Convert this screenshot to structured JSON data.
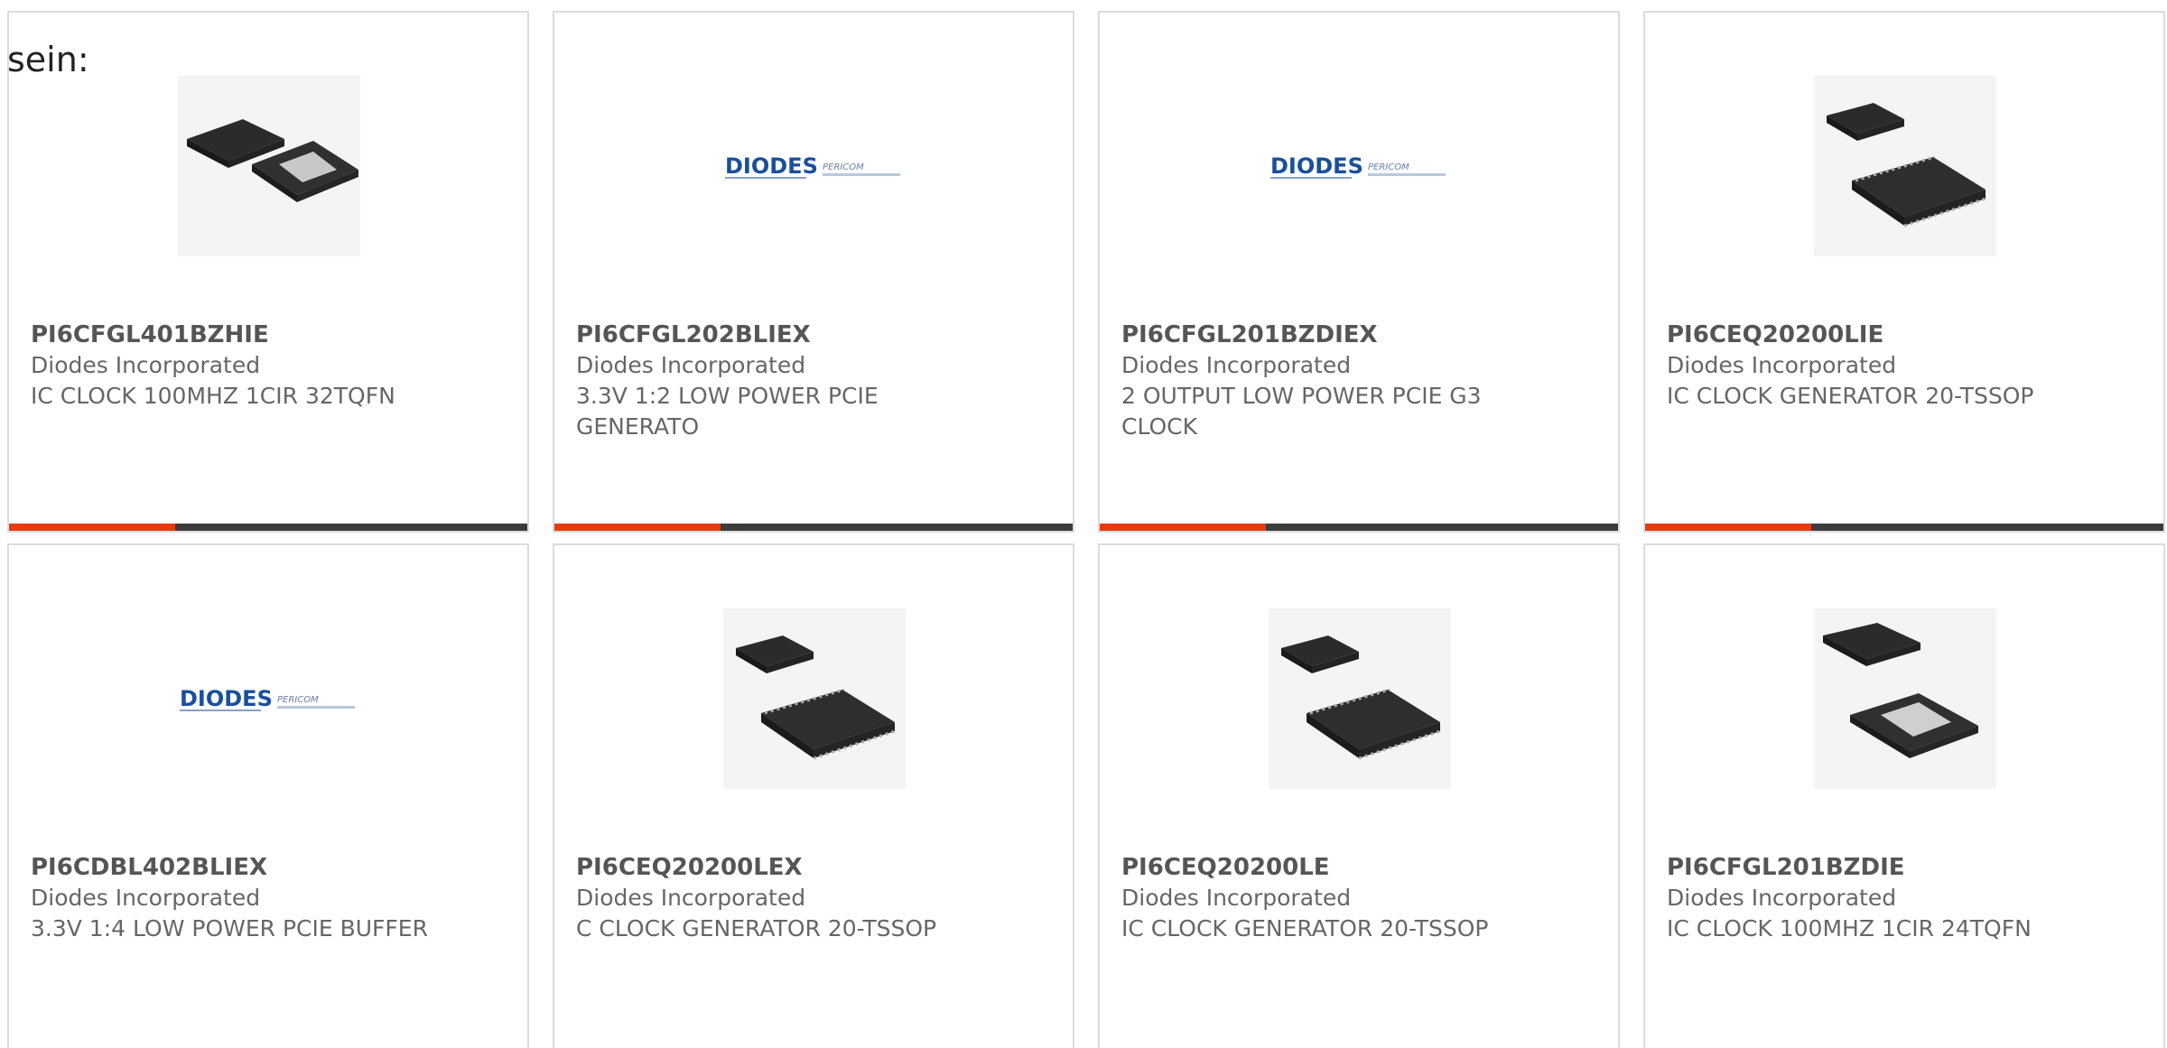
{
  "prefix_text": "sein:",
  "accent_color": "#e63a10",
  "bar_color": "#3c3c3c",
  "products": [
    {
      "part_number": "PI6CFGL401BZHIE",
      "manufacturer": "Diodes Incorporated",
      "description": "IC CLOCK 100MHZ 1CIR 32TQFN",
      "image": "qfn-chip-icon",
      "bar_fill": 0.32
    },
    {
      "part_number": "PI6CFGL202BLIEX",
      "manufacturer": "Diodes Incorporated",
      "description": "3.3V 1:2 LOW POWER PCIE GENERATO",
      "image": "diodes-pericom-logo",
      "bar_fill": 0.32
    },
    {
      "part_number": "PI6CFGL201BZDIEX",
      "manufacturer": "Diodes Incorporated",
      "description": "2 OUTPUT LOW POWER PCIE G3 CLOCK",
      "image": "diodes-pericom-logo",
      "bar_fill": 0.32
    },
    {
      "part_number": "PI6CEQ20200LIE",
      "manufacturer": "Diodes Incorporated",
      "description": "IC CLOCK GENERATOR 20-TSSOP",
      "image": "tssop-chip-icon",
      "bar_fill": 0.32
    },
    {
      "part_number": "PI6CDBL402BLIEX",
      "manufacturer": "Diodes Incorporated",
      "description": "3.3V 1:4 LOW POWER PCIE BUFFER",
      "image": "diodes-pericom-logo",
      "bar_fill": null
    },
    {
      "part_number": "PI6CEQ20200LEX",
      "manufacturer": "Diodes Incorporated",
      "description": "C CLOCK GENERATOR 20-TSSOP",
      "image": "tssop-chip-icon",
      "bar_fill": null
    },
    {
      "part_number": "PI6CEQ20200LE",
      "manufacturer": "Diodes Incorporated",
      "description": "IC CLOCK GENERATOR 20-TSSOP",
      "image": "tssop-chip-icon",
      "bar_fill": null
    },
    {
      "part_number": "PI6CFGL201BZDIE",
      "manufacturer": "Diodes Incorporated",
      "description": "IC CLOCK 100MHZ 1CIR 24TQFN",
      "image": "qfn-large-chip-icon",
      "bar_fill": null
    }
  ],
  "logo": {
    "brand": "DIODES",
    "sub": "PERICOM"
  }
}
